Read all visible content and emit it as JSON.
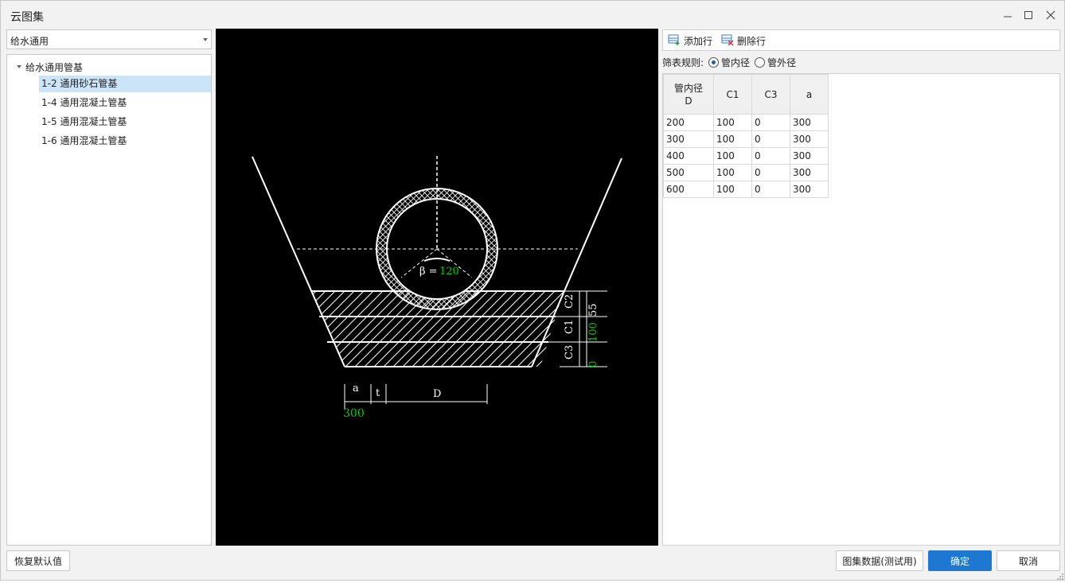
{
  "window": {
    "title": "云图集",
    "controls": [
      "minimize-icon",
      "maximize-icon",
      "close-icon"
    ]
  },
  "category_select": {
    "value": "给水通用"
  },
  "tree": {
    "root_label": "给水通用管基",
    "items": [
      {
        "label": "1-2 通用砂石管基",
        "selected": true
      },
      {
        "label": "1-4 通用混凝土管基",
        "selected": false
      },
      {
        "label": "1-5 通用混凝土管基",
        "selected": false
      },
      {
        "label": "1-6 通用混凝土管基",
        "selected": false
      }
    ]
  },
  "drawing": {
    "angle_label": "β =",
    "angle_value": "120",
    "c2_label": "C2",
    "c1_label": "C1",
    "c3_label": "C3",
    "c2_value": "55",
    "c1_value": "100",
    "c3_value": "0",
    "a_label": "a",
    "t_label": "t",
    "d_label": "D",
    "a_value": "300",
    "colors": {
      "background": "#000000",
      "lines": "#ffffff",
      "values": "#00cc00"
    }
  },
  "toolbar": {
    "add_row_label": "添加行",
    "delete_row_label": "删除行"
  },
  "filter": {
    "label": "筛表规则:",
    "options": [
      {
        "label": "管内径",
        "checked": true
      },
      {
        "label": "管外径",
        "checked": false
      }
    ]
  },
  "table": {
    "headers": [
      "管内径D",
      "C1",
      "C3",
      "a"
    ],
    "rows": [
      [
        "200",
        "100",
        "0",
        "300"
      ],
      [
        "300",
        "100",
        "0",
        "300"
      ],
      [
        "400",
        "100",
        "0",
        "300"
      ],
      [
        "500",
        "100",
        "0",
        "300"
      ],
      [
        "600",
        "100",
        "0",
        "300"
      ]
    ]
  },
  "footer": {
    "reset_label": "恢复默认值",
    "atlas_data_label": "图集数据(测试用)",
    "ok_label": "确定",
    "cancel_label": "取消"
  }
}
